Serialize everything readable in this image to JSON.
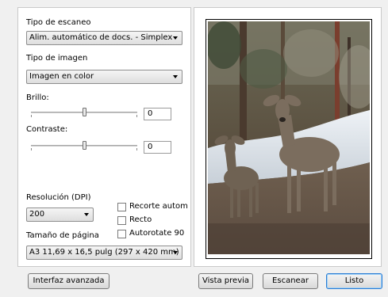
{
  "scan_type": {
    "label": "Tipo de escaneo",
    "value": "Alim. automático de docs. - Simplex"
  },
  "image_type": {
    "label": "Tipo de imagen",
    "value": "Imagen en color"
  },
  "brightness": {
    "label": "Brillo:",
    "value": "0",
    "level": 0.5
  },
  "contrast": {
    "label": "Contraste:",
    "value": "0",
    "level": 0.5
  },
  "resolution": {
    "label": "Resolución (DPI)",
    "value": "200"
  },
  "page_size": {
    "label": "Tamaño de página",
    "value": "A3 11,69 x 16,5 pulg (297 x 420 mm)"
  },
  "checkboxes": [
    {
      "label": "Recorte autom",
      "checked": false
    },
    {
      "label": "Recto",
      "checked": false
    },
    {
      "label": "Autorotate 90",
      "checked": false
    }
  ],
  "buttons": {
    "advanced": "Interfaz avanzada",
    "preview": "Vista previa",
    "scan": "Escanear",
    "done": "Listo"
  },
  "preview": {
    "image_icon": "deer-photo"
  }
}
